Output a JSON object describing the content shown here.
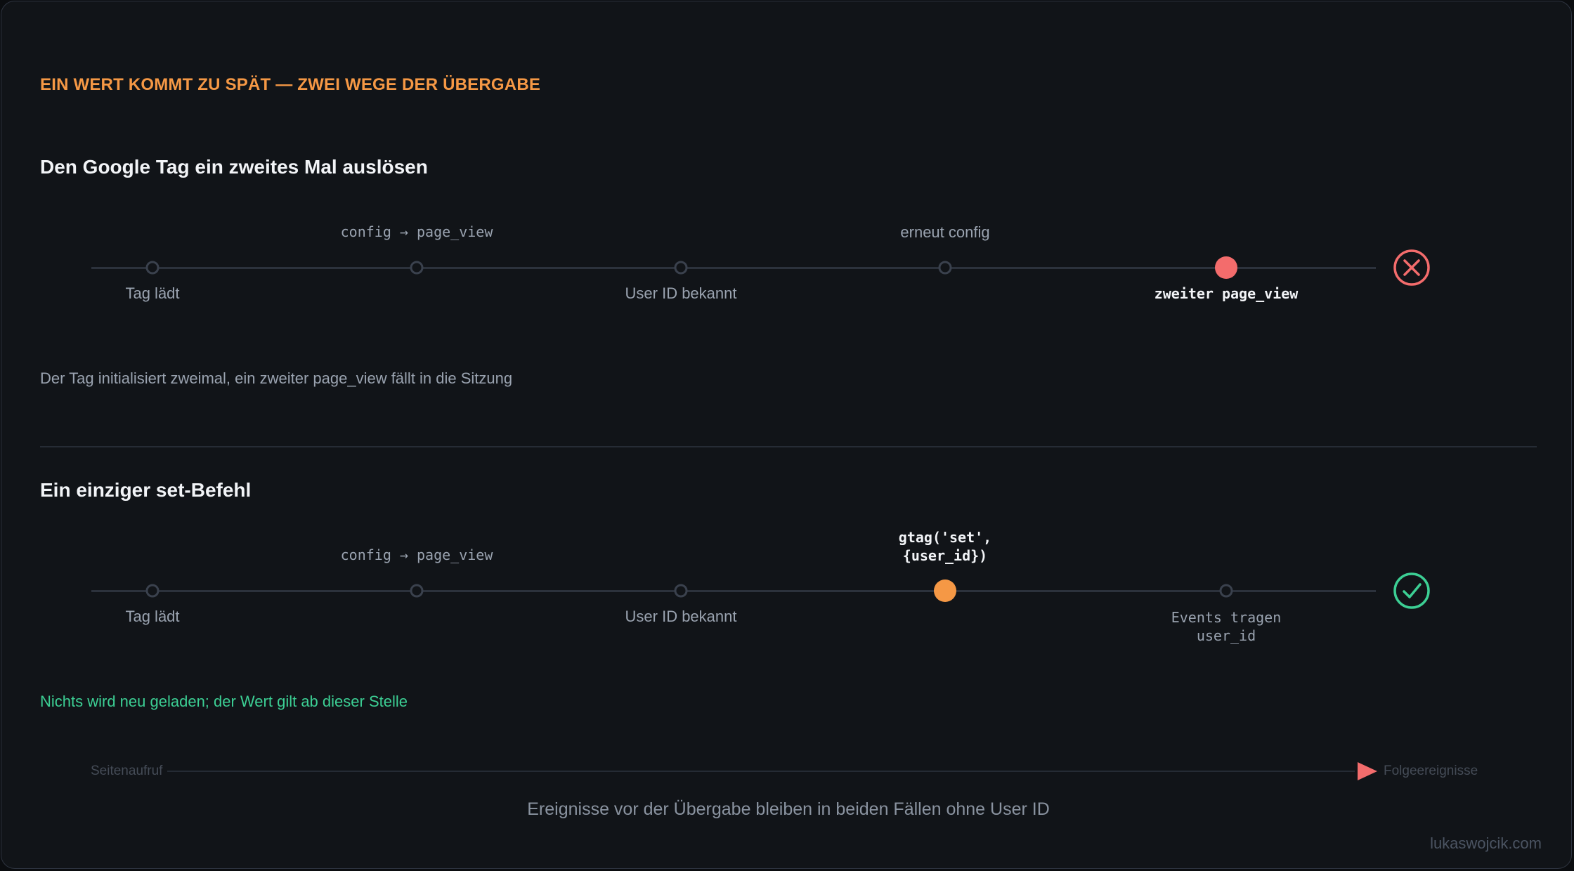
{
  "eyebrow": "EIN WERT KOMMT ZU SPÄT — ZWEI WEGE DER ÜBERGABE",
  "section1": {
    "title": "Den Google Tag ein zweites Mal auslösen",
    "steps": [
      {
        "above": "",
        "below": "Tag lädt"
      },
      {
        "above": "config → page_view",
        "below": ""
      },
      {
        "above": "",
        "below": "User ID bekannt"
      },
      {
        "above": "erneut config",
        "below": ""
      },
      {
        "above": "",
        "below": "zweiter page_view"
      }
    ],
    "result_icon": "x-circle-icon",
    "note": "Der Tag initialisiert zweimal, ein zweiter page_view fällt in die Sitzung"
  },
  "section2": {
    "title": "Ein einziger set-Befehl",
    "steps": [
      {
        "above": "",
        "below": "Tag lädt"
      },
      {
        "above": "config → page_view",
        "below": ""
      },
      {
        "above": "",
        "below": "User ID bekannt"
      },
      {
        "above_line1": "gtag('set',",
        "above_line2": "{user_id})",
        "below": ""
      },
      {
        "above": "",
        "below_line1": "Events tragen",
        "below_line2": "user_id"
      }
    ],
    "result_icon": "check-circle-icon",
    "note": "Nichts wird neu geladen; der Wert gilt ab dieser Stelle"
  },
  "axis": {
    "start": "Seitenaufruf",
    "end": "Folgeereignisse"
  },
  "footer": "Ereignisse vor der Übergabe bleiben in beiden Fällen ohne User ID",
  "brand": "lukaswojcik.com",
  "colors": {
    "accent_orange": "#f59845",
    "error_red": "#f36c6c",
    "success_green": "#3ccf94"
  }
}
